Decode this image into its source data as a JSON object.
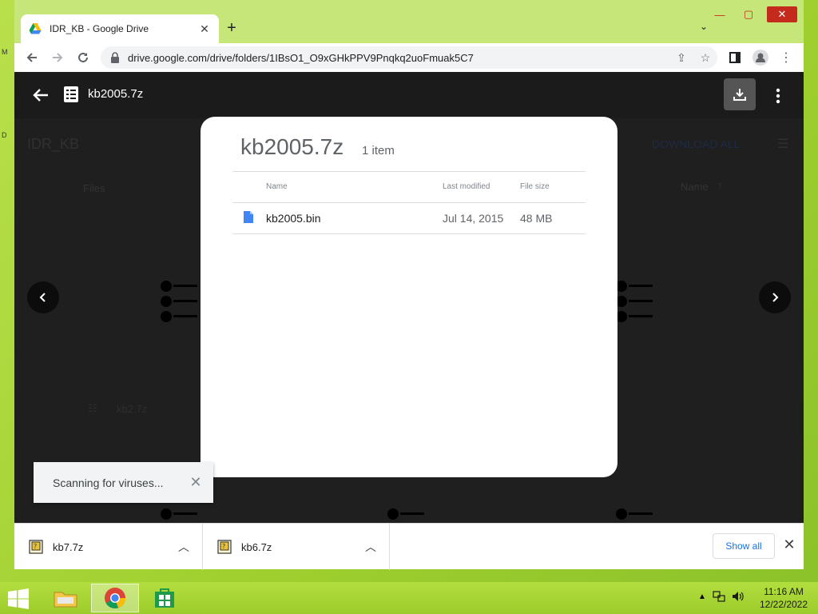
{
  "desktop": {
    "edge_labels": [
      "M",
      "D"
    ]
  },
  "browser": {
    "tab_title": "IDR_KB - Google Drive",
    "url": "drive.google.com/drive/folders/1IBsO1_O9xGHkPPV9Pnqkq2uoFmuak5C7"
  },
  "background": {
    "folder_title": "IDR_KB",
    "download_all": "DOWNLOAD ALL",
    "files_header": "Files",
    "name_header": "Name",
    "bg_file": "kb2.7z"
  },
  "viewer": {
    "file_title": "kb2005.7z"
  },
  "card": {
    "title": "kb2005.7z",
    "count": "1 item",
    "columns": {
      "name": "Name",
      "modified": "Last modified",
      "size": "File size"
    },
    "rows": [
      {
        "name": "kb2005.bin",
        "modified": "Jul 14, 2015",
        "size": "48 MB"
      }
    ]
  },
  "toast": {
    "text": "Scanning for viruses..."
  },
  "shelf": {
    "items": [
      {
        "name": "kb7.7z"
      },
      {
        "name": "kb6.7z"
      }
    ],
    "show_all": "Show all"
  },
  "taskbar": {
    "time": "11:16 AM",
    "date": "12/22/2022"
  },
  "colors": {
    "accent_blue": "#1a73e8",
    "close_red": "#c42b1c",
    "desktop_green": "#a8d43a"
  }
}
